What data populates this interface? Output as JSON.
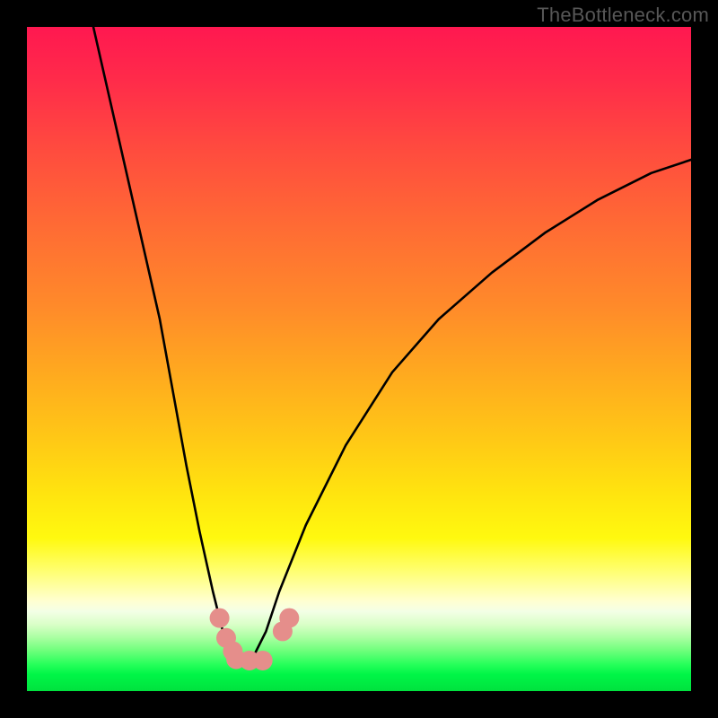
{
  "watermark": "TheBottleneck.com",
  "chart_data": {
    "type": "line",
    "title": "",
    "xlabel": "",
    "ylabel": "",
    "xlim": [
      0,
      100
    ],
    "ylim": [
      0,
      100
    ],
    "series": [
      {
        "name": "bottleneck-curve",
        "x": [
          10,
          15,
          20,
          24,
          26,
          28,
          29.5,
          31,
          32,
          33,
          34,
          36,
          38,
          42,
          48,
          55,
          62,
          70,
          78,
          86,
          94,
          100
        ],
        "y": [
          100,
          78,
          56,
          34,
          24,
          15,
          9,
          5,
          4.5,
          4.5,
          5,
          9,
          15,
          25,
          37,
          48,
          56,
          63,
          69,
          74,
          78,
          80
        ]
      }
    ],
    "markers": [
      {
        "name": "cluster-left-1",
        "x": 29.0,
        "y": 11.0
      },
      {
        "name": "cluster-left-2",
        "x": 30.0,
        "y": 8.0
      },
      {
        "name": "cluster-left-3",
        "x": 31.0,
        "y": 6.0
      },
      {
        "name": "cluster-bottom-1",
        "x": 31.5,
        "y": 4.8
      },
      {
        "name": "cluster-bottom-2",
        "x": 33.5,
        "y": 4.6
      },
      {
        "name": "cluster-bottom-3",
        "x": 35.5,
        "y": 4.6
      },
      {
        "name": "cluster-right-1",
        "x": 38.5,
        "y": 9.0
      },
      {
        "name": "cluster-right-2",
        "x": 39.5,
        "y": 11.0
      }
    ],
    "colors": {
      "curve": "#000000",
      "marker": "#e58e8b",
      "gradient_top": "#ff1850",
      "gradient_bottom": "#00e23e"
    }
  }
}
